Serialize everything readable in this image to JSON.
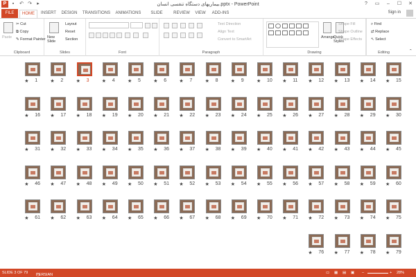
{
  "title_bar": {
    "app_icon": "P",
    "title": "بیماریهای دستگاه تنفسی انسان.pptx - PowerPoint",
    "window_controls": [
      "?",
      "▭",
      "–",
      "☐",
      "✕"
    ]
  },
  "tabs": {
    "file": "FILE",
    "items": [
      "HOME",
      "INSERT",
      "DESIGN",
      "TRANSITIONS",
      "ANIMATIONS",
      "SLIDE SHOW",
      "REVIEW",
      "VIEW",
      "ADD-INS"
    ],
    "active": "HOME",
    "sign_in": "Sign in"
  },
  "ribbon": {
    "clipboard": {
      "paste": "Paste",
      "cut": "Cut",
      "copy": "Copy",
      "format_painter": "Format Painter",
      "label": "Clipboard"
    },
    "slides": {
      "new_slide": "New Slide",
      "layout": "Layout",
      "reset": "Reset",
      "section": "Section",
      "label": "Slides"
    },
    "font": {
      "label": "Font"
    },
    "paragraph": {
      "text_direction": "Text Direction",
      "align_text": "Align Text",
      "convert_smartart": "Convert to SmartArt",
      "label": "Paragraph"
    },
    "drawing": {
      "arrange": "Arrange",
      "quick_styles": "Quick Styles",
      "shape_fill": "Shape Fill",
      "shape_outline": "Shape Outline",
      "shape_effects": "Shape Effects",
      "label": "Drawing"
    },
    "editing": {
      "find": "Find",
      "replace": "Replace",
      "select": "Select",
      "label": "Editing"
    }
  },
  "slides": [
    {
      "num": "15"
    },
    {
      "num": "14"
    },
    {
      "num": "13"
    },
    {
      "num": "12"
    },
    {
      "num": "11"
    },
    {
      "num": "10"
    },
    {
      "num": "9"
    },
    {
      "num": "8"
    },
    {
      "num": "7"
    },
    {
      "num": "6"
    },
    {
      "num": "5"
    },
    {
      "num": "4"
    },
    {
      "num": "3",
      "selected": true
    },
    {
      "num": "2"
    },
    {
      "num": "1"
    },
    {
      "num": "30"
    },
    {
      "num": "29"
    },
    {
      "num": "28"
    },
    {
      "num": "27"
    },
    {
      "num": "26"
    },
    {
      "num": "25"
    },
    {
      "num": "24"
    },
    {
      "num": "23"
    },
    {
      "num": "22"
    },
    {
      "num": "21"
    },
    {
      "num": "20"
    },
    {
      "num": "19"
    },
    {
      "num": "18"
    },
    {
      "num": "17"
    },
    {
      "num": "16"
    },
    {
      "num": "45"
    },
    {
      "num": "44"
    },
    {
      "num": "43"
    },
    {
      "num": "42"
    },
    {
      "num": "41"
    },
    {
      "num": "40"
    },
    {
      "num": "39"
    },
    {
      "num": "38"
    },
    {
      "num": "37"
    },
    {
      "num": "36"
    },
    {
      "num": "35"
    },
    {
      "num": "34"
    },
    {
      "num": "33"
    },
    {
      "num": "32"
    },
    {
      "num": "31"
    },
    {
      "num": "60"
    },
    {
      "num": "59"
    },
    {
      "num": "58"
    },
    {
      "num": "57"
    },
    {
      "num": "56"
    },
    {
      "num": "55"
    },
    {
      "num": "54"
    },
    {
      "num": "53"
    },
    {
      "num": "52"
    },
    {
      "num": "51"
    },
    {
      "num": "50"
    },
    {
      "num": "49"
    },
    {
      "num": "48"
    },
    {
      "num": "47"
    },
    {
      "num": "46"
    },
    {
      "num": "75"
    },
    {
      "num": "74"
    },
    {
      "num": "73"
    },
    {
      "num": "72"
    },
    {
      "num": "71"
    },
    {
      "num": "70"
    },
    {
      "num": "69"
    },
    {
      "num": "68"
    },
    {
      "num": "67"
    },
    {
      "num": "66"
    },
    {
      "num": "65"
    },
    {
      "num": "64"
    },
    {
      "num": "63"
    },
    {
      "num": "62"
    },
    {
      "num": "61"
    },
    {
      "num": "79"
    },
    {
      "num": "78"
    },
    {
      "num": "77"
    },
    {
      "num": "76"
    }
  ],
  "slide_star": "★",
  "status_bar": {
    "slide_info": "SLIDE 3 OF 79",
    "language": "PERSIAN",
    "zoom": "28%"
  },
  "colors": {
    "accent": "#d24726"
  }
}
